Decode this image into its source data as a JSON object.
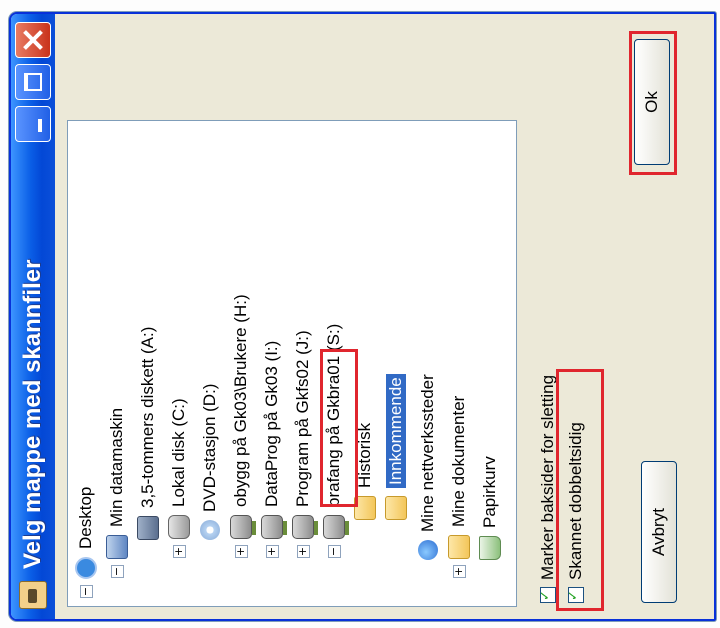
{
  "window": {
    "title": "Velg mappe med skannfiler"
  },
  "tree": {
    "items": [
      {
        "label": "Desktop",
        "icon": "desktop-icon",
        "expander": "−"
      },
      {
        "label": "Min datamaskin",
        "icon": "computer-icon",
        "expander": "−"
      },
      {
        "label": "3,5-tommers diskett (A:)",
        "icon": "floppy-drive-icon",
        "expander": ""
      },
      {
        "label": "Lokal disk (C:)",
        "icon": "hard-disk-icon",
        "expander": "+"
      },
      {
        "label": "DVD-stasjon (D:)",
        "icon": "dvd-drive-icon",
        "expander": ""
      },
      {
        "label": "obygg på Gk03\\Brukere (H:)",
        "icon": "network-drive-icon",
        "expander": "+"
      },
      {
        "label": "DataProg på Gk03 (I:)",
        "icon": "network-drive-icon",
        "expander": "+"
      },
      {
        "label": "Program på Gkfs02 (J:)",
        "icon": "network-drive-icon",
        "expander": "+"
      },
      {
        "label": "brafang på Gkbra01 (S:)",
        "icon": "network-drive-icon",
        "expander": "−"
      },
      {
        "label": "Historisk",
        "icon": "folder-icon",
        "expander": ""
      },
      {
        "label": "Innkommende",
        "icon": "folder-icon",
        "expander": "",
        "selected": true
      },
      {
        "label": "Mine nettverkssteder",
        "icon": "network-places-icon",
        "expander": ""
      },
      {
        "label": "Mine dokumenter",
        "icon": "folder-icon",
        "expander": "+"
      },
      {
        "label": "Papirkurv",
        "icon": "recycle-bin-icon",
        "expander": ""
      }
    ]
  },
  "options": {
    "mark_backsides": {
      "label": "Marker baksider for sletting",
      "checked": true
    },
    "scan_duplex": {
      "label": "Skannet dobbeltsidig",
      "checked": true
    }
  },
  "buttons": {
    "ok": "Ok",
    "cancel": "Avbryt"
  },
  "colors": {
    "highlight": "#e0262e",
    "selection": "#316ac5",
    "titlebar": "#0a5ee6"
  }
}
